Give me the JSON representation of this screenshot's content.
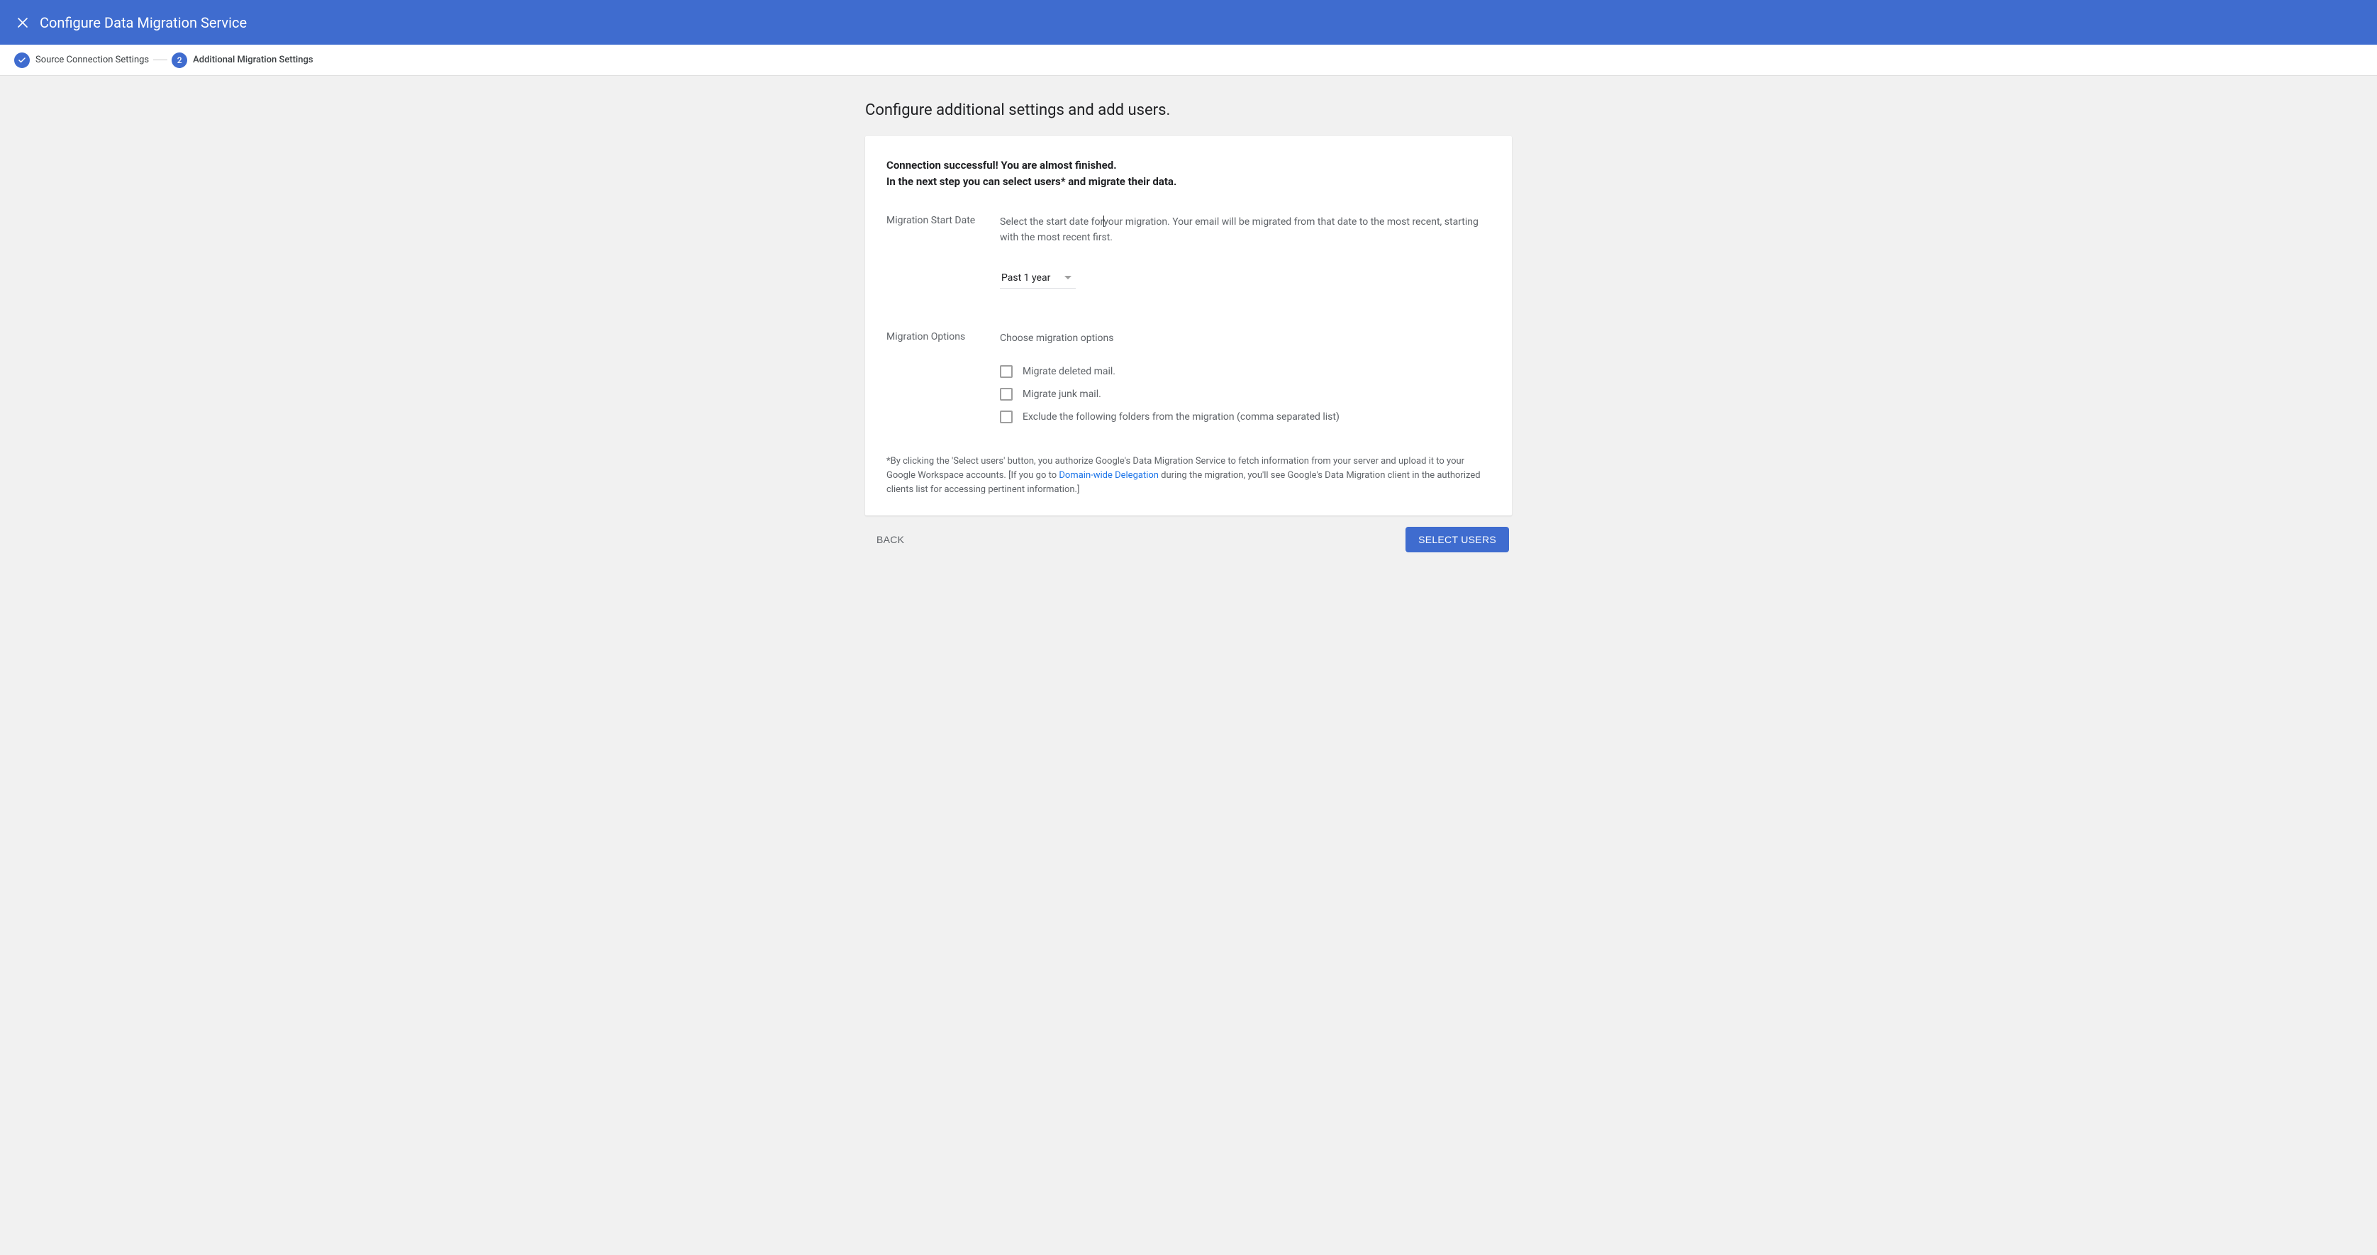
{
  "header": {
    "title": "Configure Data Migration Service"
  },
  "stepper": {
    "step1_label": "Source Connection Settings",
    "step2_number": "2",
    "step2_label": "Additional Migration Settings"
  },
  "page": {
    "heading": "Configure additional settings and add users.",
    "intro_line1": "Connection successful! You are almost finished.",
    "intro_line2": "In the next step you can select users* and migrate their data.",
    "start_date": {
      "label": "Migration Start Date",
      "help_prefix": "Select the start date for",
      "help_suffix": "your migration. Your email will be migrated from that date to the most recent, starting with the most recent first.",
      "selected": "Past 1 year"
    },
    "options": {
      "label": "Migration Options",
      "help": "Choose migration options",
      "items": [
        "Migrate deleted mail.",
        "Migrate junk mail.",
        "Exclude the following folders from the migration (comma separated list)"
      ]
    },
    "disclaimer_prefix": "*By clicking the 'Select users' button, you authorize Google's Data Migration Service to fetch information from your server and upload it to your Google Workspace accounts. [If you go to ",
    "disclaimer_link": "Domain-wide Delegation",
    "disclaimer_suffix": " during the migration, you'll see Google's Data Migration client in the authorized clients list for accessing pertinent information.]"
  },
  "buttons": {
    "back": "BACK",
    "select_users": "SELECT USERS"
  }
}
